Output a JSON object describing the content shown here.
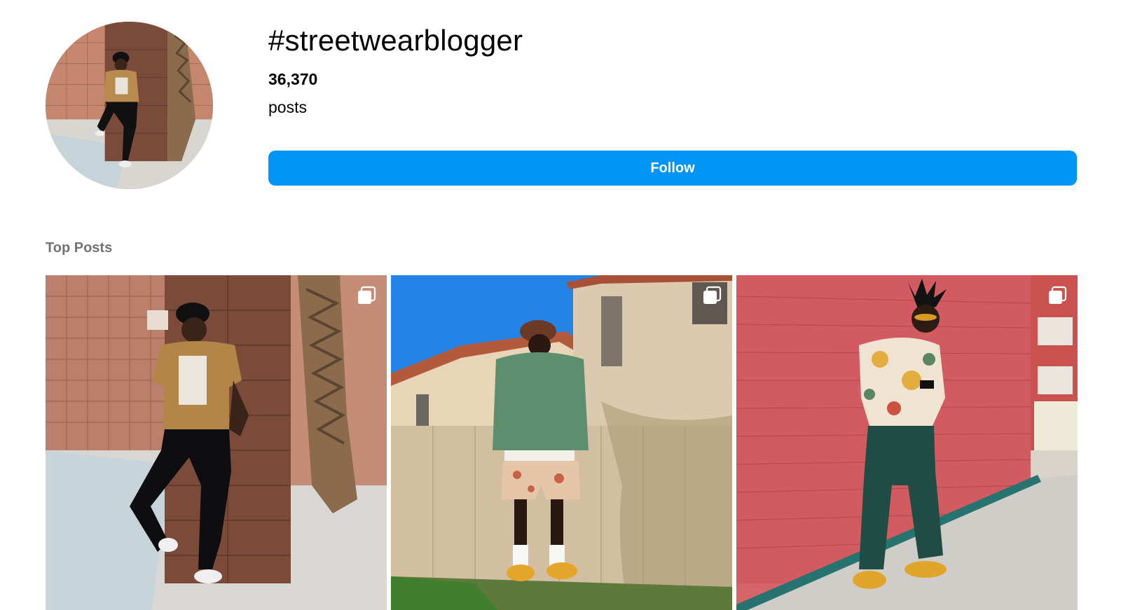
{
  "header": {
    "hashtag": "#streetwearblogger",
    "post_count": "36,370",
    "post_label": "posts",
    "follow_label": "Follow",
    "follow_color": "#0095f6",
    "avatar_icon": "profile-photo"
  },
  "top_posts": {
    "title": "Top Posts",
    "title_color": "#737373",
    "posts": [
      {
        "name": "post-1",
        "has_carousel": true,
        "icon": "carousel-icon"
      },
      {
        "name": "post-2",
        "has_carousel": true,
        "icon": "carousel-icon"
      },
      {
        "name": "post-3",
        "has_carousel": true,
        "icon": "carousel-icon"
      }
    ]
  }
}
